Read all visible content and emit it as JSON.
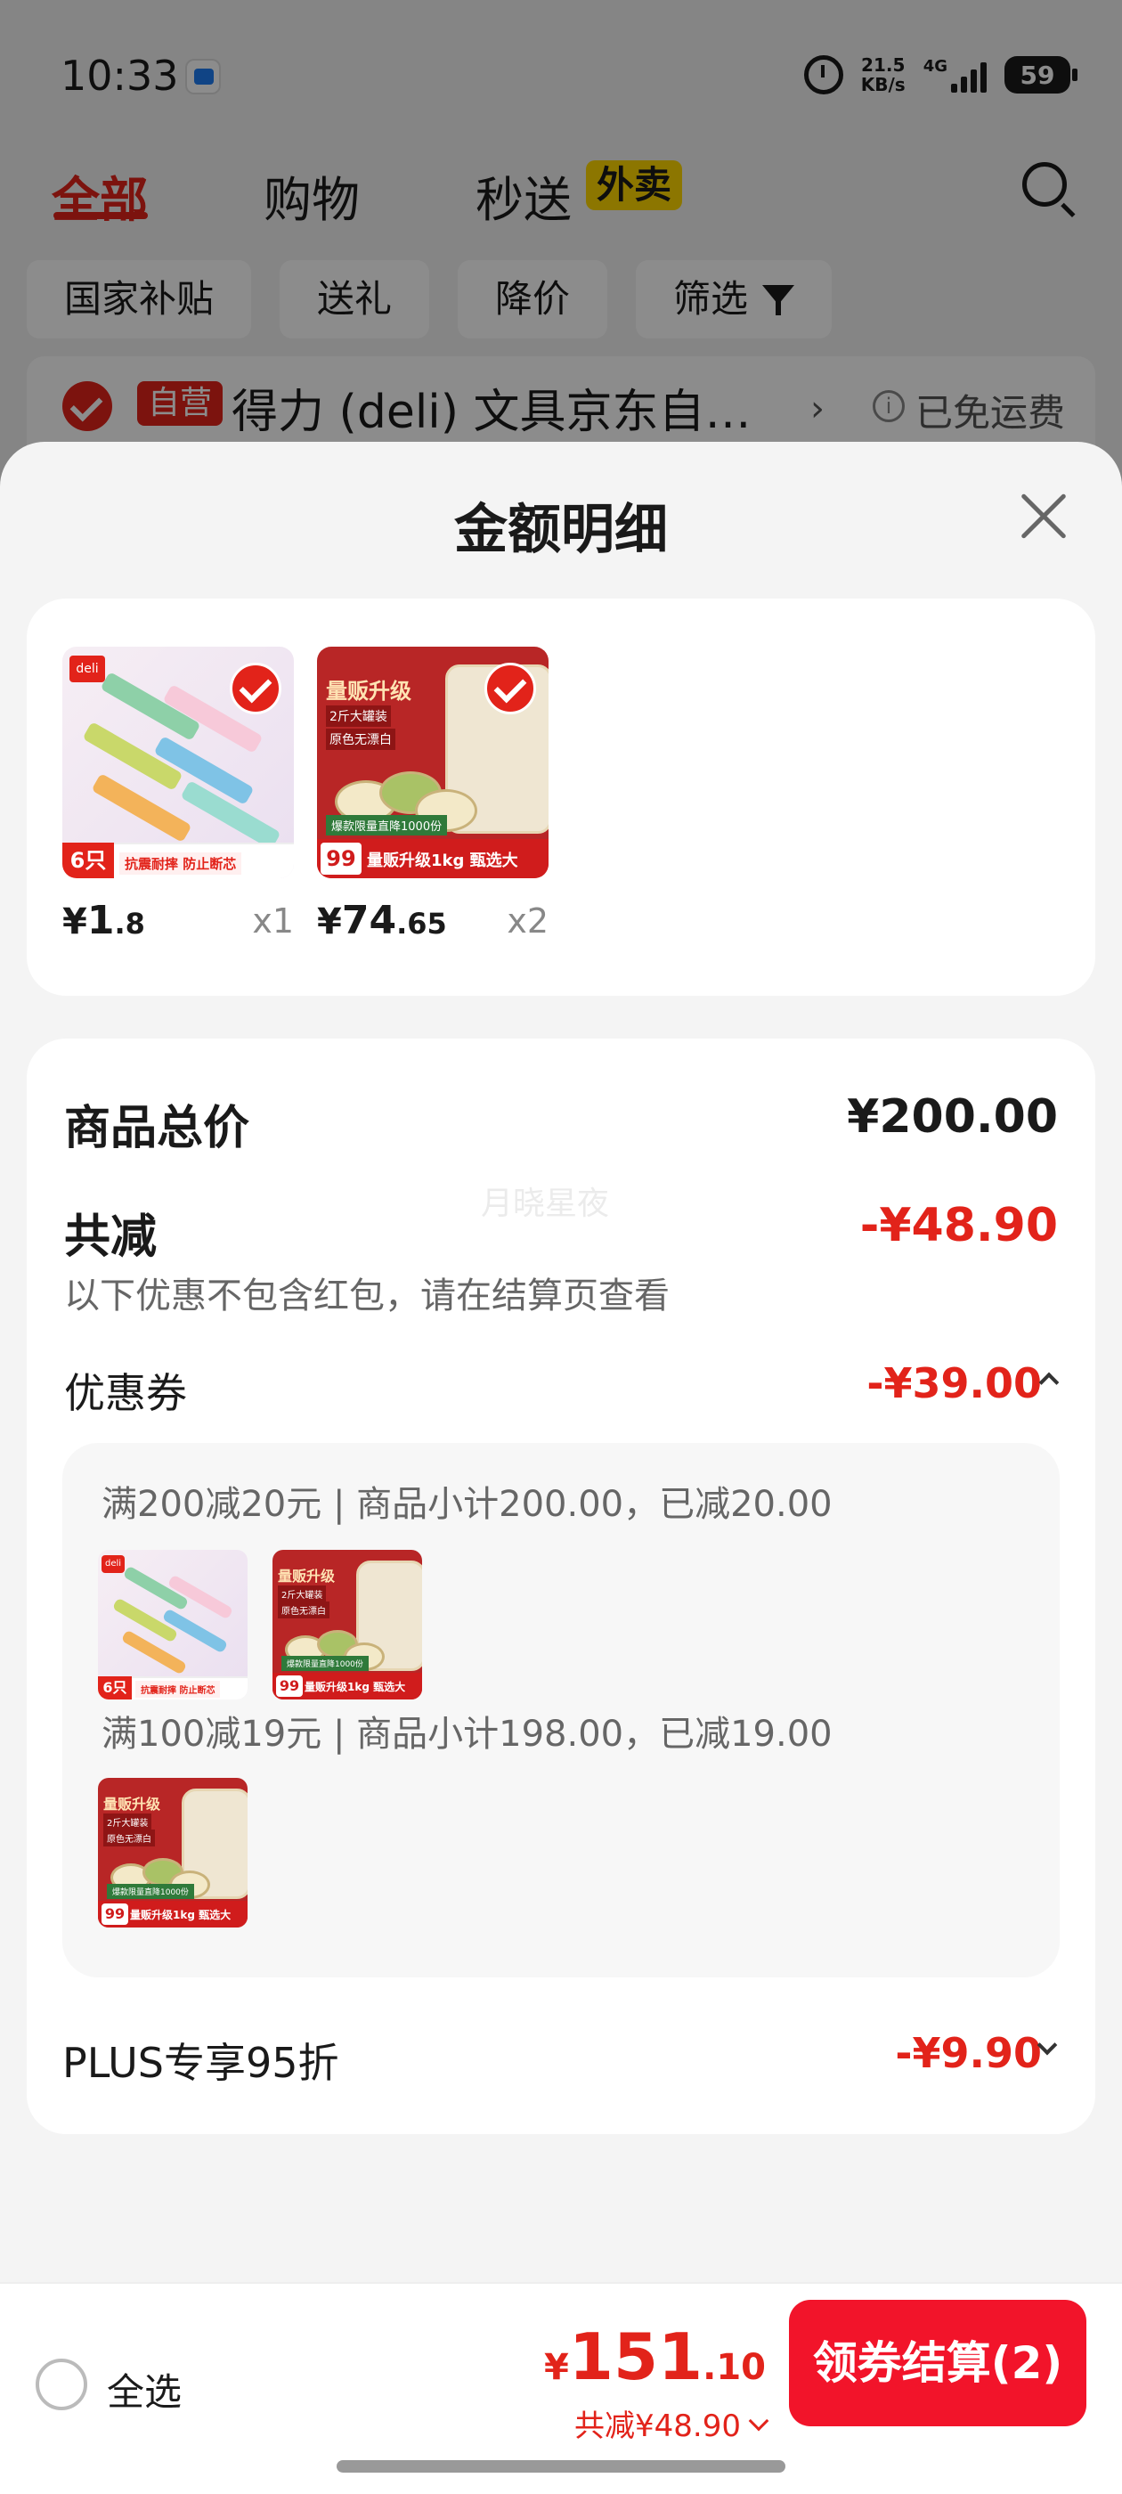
{
  "status_bar": {
    "time": "10:33",
    "net_speed_value": "21.5",
    "net_speed_unit": "KB/s",
    "network": "4G",
    "battery": "59"
  },
  "tabs": [
    {
      "label": "全部",
      "active": true
    },
    {
      "label": "购物",
      "active": false
    },
    {
      "label": "秒送",
      "active": false
    }
  ],
  "tab_badge": "外卖",
  "chips": [
    {
      "label": "国家补贴"
    },
    {
      "label": "送礼"
    },
    {
      "label": "降价"
    },
    {
      "label": "筛选"
    }
  ],
  "store": {
    "badge": "自营",
    "name": "得力 (deli) 文具京东自…",
    "shipping": "已免运费"
  },
  "sheet": {
    "title": "金额明细",
    "products": [
      {
        "name": "pencils",
        "price_symbol": "¥",
        "price_int": "1",
        "price_dec": ".8",
        "qty": "x1",
        "art": {
          "brand": "deli",
          "count": "6只",
          "strip": "抗震耐摔 防止断芯"
        }
      },
      {
        "name": "pistachios",
        "price_symbol": "¥",
        "price_int": "74",
        "price_dec": ".65",
        "qty": "x2",
        "art": {
          "title": "量贩升级",
          "tag1": "2斤大罐装",
          "tag2": "原色无漂白",
          "badge": "99",
          "strip": "量贩升级1kg 甄选大",
          "promo": "爆款限量直降1000份"
        }
      }
    ],
    "summary": {
      "total_label": "商品总价",
      "total_value": "¥200.00",
      "discount_label": "共减",
      "discount_value": "-¥48.90",
      "note": "以下优惠不包含红包，请在结算页查看",
      "watermark": "月晓星夜"
    },
    "coupon": {
      "label": "优惠券",
      "value": "-¥39.00",
      "groups": [
        {
          "text": "满200减20元 | 商品小计200.00，已减20.00"
        },
        {
          "text": "满100减19元 | 商品小计198.00，已减19.00"
        }
      ]
    },
    "plus": {
      "label": "PLUS专享95折",
      "value": "-¥9.90"
    }
  },
  "bottom_bar": {
    "select_all": "全选",
    "total_symbol": "¥",
    "total_int": "151",
    "total_dec": ".10",
    "total_discount": "共减¥48.90",
    "checkout": "领券结算(2)"
  },
  "colors": {
    "accent_red": "#e2231a",
    "checkout_red": "#f2142a",
    "sheet_bg": "#f4f4f4"
  }
}
